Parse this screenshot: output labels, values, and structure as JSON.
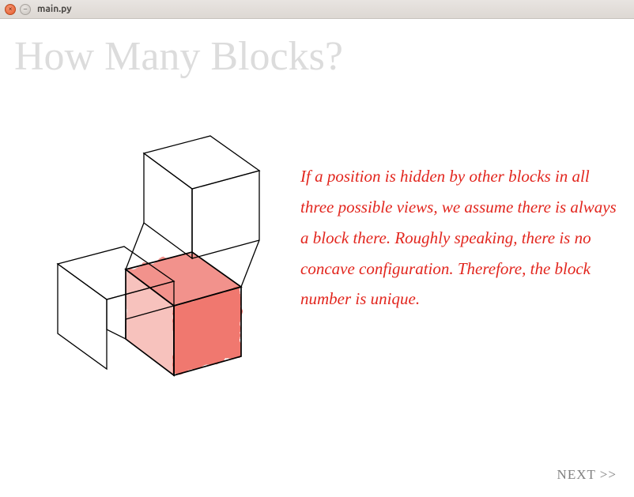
{
  "window": {
    "title": "main.py"
  },
  "page": {
    "heading": "How Many Blocks?",
    "body_text": "If a position is hidden by other blocks in all three possible views, we assume there is always a block there. Roughly speaking, there is no concave configuration. Therefore, the block number is unique.",
    "next_label": "NEXT >>"
  }
}
